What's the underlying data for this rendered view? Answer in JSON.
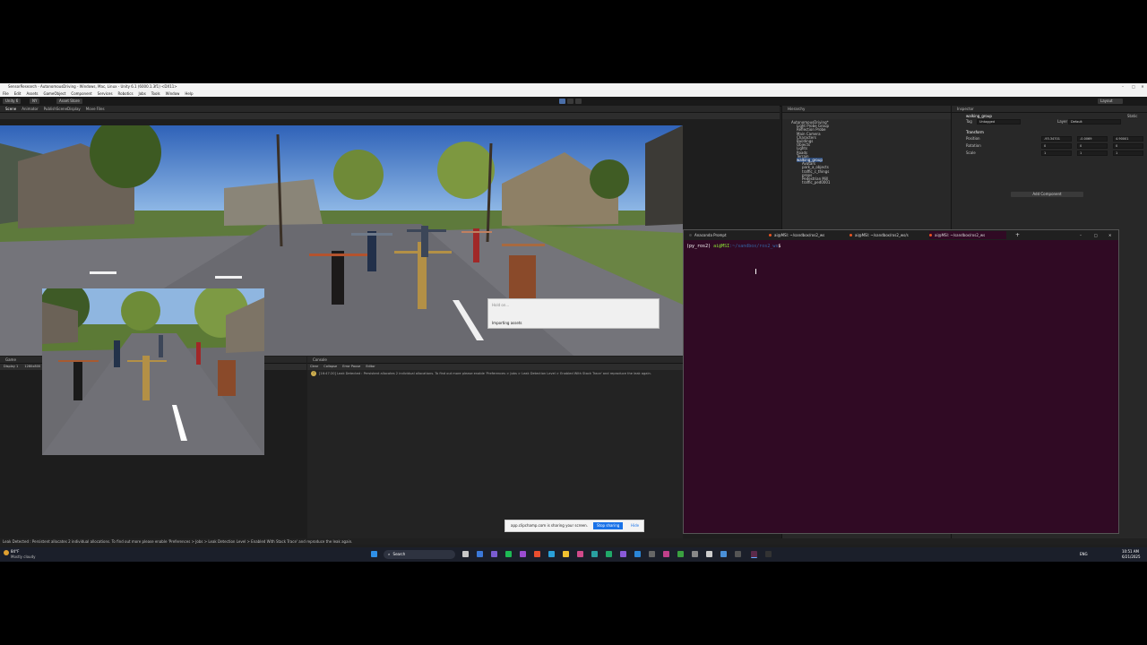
{
  "unity": {
    "window_title": "SensorResearch - AutonomousDriving - Windows, Mac, Linux - Unity 6.1 (6000.1.3f1) <DX11>",
    "menu": [
      "File",
      "Edit",
      "Assets",
      "GameObject",
      "Component",
      "Services",
      "Robotics",
      "Jobs",
      "Tools",
      "Window",
      "Help"
    ],
    "toolbar": {
      "account": "Unity 6",
      "cloud": "NY",
      "asset_store": "Asset Store",
      "layout": "Layout"
    },
    "scene_tabs": [
      "Scene",
      "Animator",
      "PublishSceneDisplay",
      "Move Files"
    ],
    "hierarchy": {
      "title": "Hierarchy",
      "items": [
        "AutonomousDriving*",
        "Light Probe Group",
        "Reflection Probe",
        "Main Camera",
        "Characters",
        "Buildings",
        "Objects",
        "Lights",
        "Roads",
        "Terrain",
        "walking_group",
        "Avatars",
        "park_a_objects",
        "traffic_c_things",
        "props",
        "Pedestrian Mill",
        "traffic_ped0001"
      ]
    },
    "inspector": {
      "title": "Inspector",
      "object_name": "walking_group",
      "static_label": "Static",
      "tag_label": "Tag",
      "tag_value": "Untagged",
      "layer_label": "Layer",
      "layer_value": "Default",
      "component": "Transform",
      "rows": [
        {
          "label": "Position",
          "x": "-93.34701",
          "y": "-0.0069",
          "z": "4.90001"
        },
        {
          "label": "Rotation",
          "x": "0",
          "y": "0",
          "z": "0"
        },
        {
          "label": "Scale",
          "x": "1",
          "y": "1",
          "z": "1"
        }
      ],
      "add_component": "Add Component"
    },
    "game": {
      "tab": "Game",
      "display": "Display 1",
      "resolution": "1280x800",
      "scale_label": "Scale",
      "scale_value": "0.51x",
      "play_focused": "Play Focused"
    },
    "console": {
      "tab": "Console",
      "buttons": [
        "Clear",
        "Collapse",
        "Error Pause",
        "Editor"
      ],
      "message": "[16:47:20] Leak Detected : Persistent allocates 2 individual allocations. To find out more please enable 'Preferences > Jobs > Leak Detection Level > Enabled With Stack Trace' and reproduce the leak again."
    },
    "status_bar": "Leak Detected : Persistent allocates 2 individual allocations. To find out more please enable 'Preferences > Jobs > Leak Detection Level > Enabled With Stack Trace' and reproduce the leak again.",
    "progress_dialog": {
      "title": "Hold on...",
      "text": "Importing assets"
    }
  },
  "terminal": {
    "tabs": [
      "Anaconda Prompt",
      "ai@MSI: ~/sandbox/ros2_ws",
      "ai@MSI: ~/sandbox/ros2_ws/s",
      "ai@MSI: ~/sandbox/ros2_ws"
    ],
    "prompt_env": "(py_ros2)",
    "prompt_user": "ai@MSI",
    "prompt_path": ":~/sandbox/ros2_ws",
    "prompt_symbol": "$"
  },
  "share_bar": {
    "text": "app.clipchamp.com is sharing your screen.",
    "stop": "Stop sharing",
    "hide": "Hide"
  },
  "taskbar": {
    "weather_temp": "84°F",
    "weather_text": "Mostly cloudy",
    "search": "Search",
    "lang": "ENG",
    "time": "10:51 AM",
    "date": "6/21/2025"
  },
  "colors": {
    "terminal_bg": "#300a24",
    "unity_bg": "#1e1e1e",
    "accent": "#4a6ea8"
  }
}
